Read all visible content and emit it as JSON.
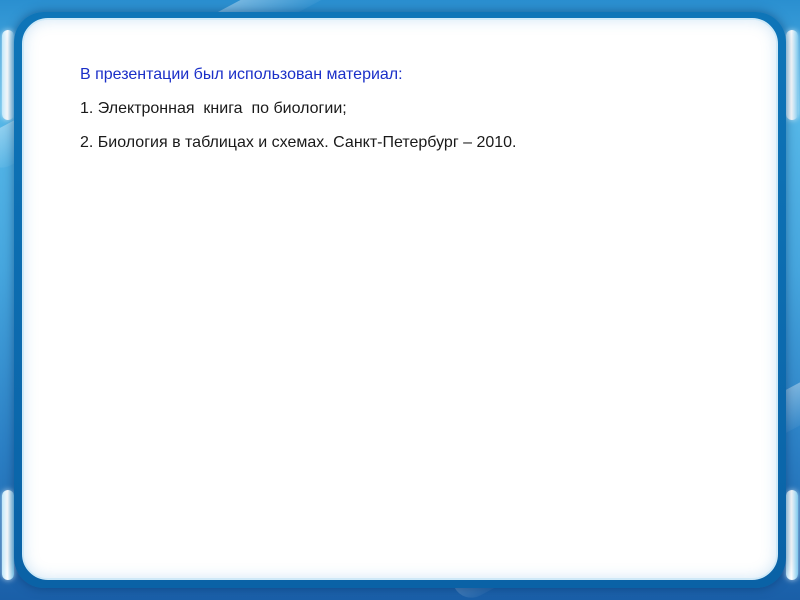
{
  "slide": {
    "heading": "В презентации был использован материал:",
    "sources": [
      "1. Электронная  книга  по биологии;",
      "2. Биология в таблицах и схемах. Санкт-Петербург – 2010."
    ]
  },
  "colors": {
    "heading_text": "#1a2fc8",
    "body_text": "#1a1a1a",
    "background": "#46a6de",
    "panel_frame": "#0a62a6",
    "panel_fill": "#ffffff"
  }
}
